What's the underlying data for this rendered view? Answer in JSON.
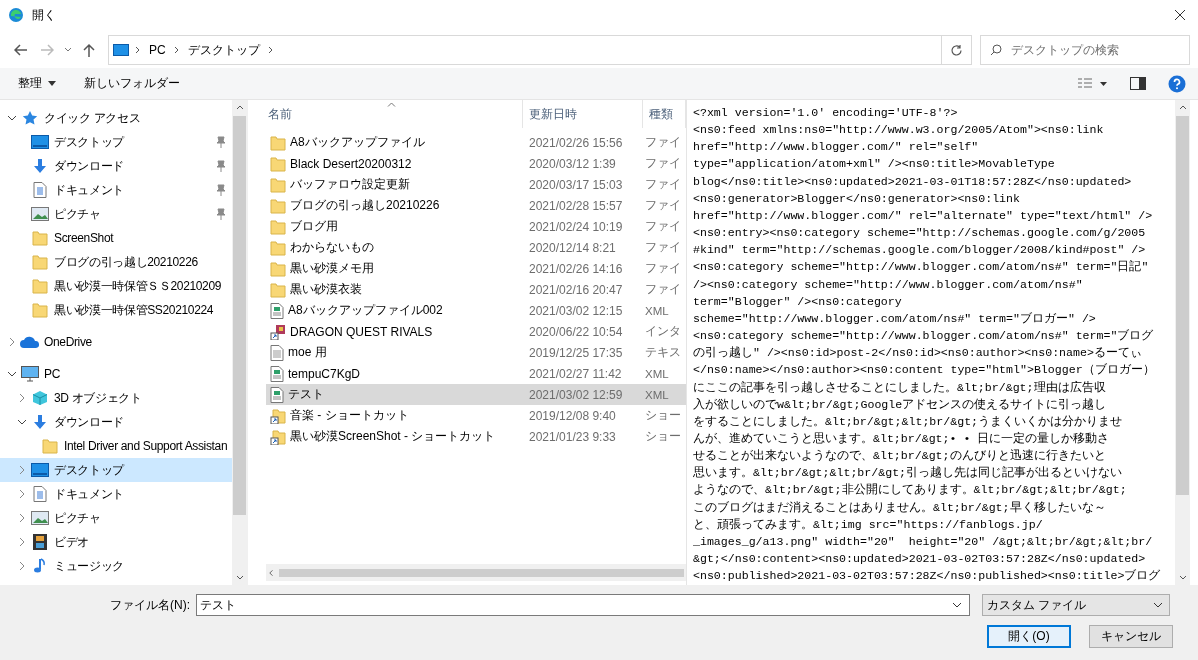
{
  "window": {
    "title": "開く"
  },
  "address": {
    "path": [
      "PC",
      "デスクトップ"
    ]
  },
  "search": {
    "placeholder": "デスクトップの検索"
  },
  "toolbar": {
    "organize": "整理",
    "new_folder": "新しいフォルダー"
  },
  "sidebar": {
    "items": [
      {
        "label": "クイック アクセス",
        "kind": "star",
        "expanded": true,
        "selected": false,
        "children": [
          {
            "label": "デスクトップ",
            "kind": "desktop",
            "pinned": true,
            "selected": false
          },
          {
            "label": "ダウンロード",
            "kind": "download",
            "pinned": true,
            "selected": false
          },
          {
            "label": "ドキュメント",
            "kind": "document",
            "pinned": true,
            "selected": false
          },
          {
            "label": "ピクチャ",
            "kind": "picture",
            "pinned": true,
            "selected": false
          },
          {
            "label": "ScreenShot",
            "kind": "folder",
            "pinned": false,
            "selected": false
          },
          {
            "label": "ブログの引っ越し20210226",
            "kind": "folder",
            "pinned": false,
            "selected": false
          },
          {
            "label": "黒い砂漠一時保管ＳＳ20210209",
            "kind": "folder",
            "pinned": false,
            "selected": false
          },
          {
            "label": "黒い砂漠一時保管SS20210224",
            "kind": "folder",
            "pinned": false,
            "selected": false
          }
        ]
      },
      {
        "label": "OneDrive",
        "kind": "cloud",
        "expanded": false,
        "selected": false
      },
      {
        "label": "PC",
        "kind": "pc",
        "expanded": true,
        "selected": false,
        "children": [
          {
            "label": "3D オブジェクト",
            "kind": "cube",
            "expanded": false,
            "selected": false
          },
          {
            "label": "ダウンロード",
            "kind": "download",
            "expanded": true,
            "selected": false,
            "children": [
              {
                "label": "Intel Driver and Support Assistan",
                "kind": "folder",
                "selected": false
              }
            ]
          },
          {
            "label": "デスクトップ",
            "kind": "desktop",
            "expanded": false,
            "selected": true
          },
          {
            "label": "ドキュメント",
            "kind": "document",
            "expanded": false,
            "selected": false
          },
          {
            "label": "ピクチャ",
            "kind": "picture",
            "expanded": false,
            "selected": false
          },
          {
            "label": "ビデオ",
            "kind": "video",
            "expanded": false,
            "selected": false
          },
          {
            "label": "ミュージック",
            "kind": "music",
            "expanded": false,
            "selected": false
          }
        ]
      }
    ]
  },
  "table": {
    "columns": [
      "名前",
      "更新日時",
      "種類"
    ],
    "rows": [
      {
        "name": "A8バックアップファイル",
        "date": "2021/02/26 15:56",
        "type": "ファイ",
        "kind": "folder",
        "selected": false
      },
      {
        "name": "Black Desert20200312",
        "date": "2020/03/12 1:39",
        "type": "ファイ",
        "kind": "folder",
        "selected": false
      },
      {
        "name": "バッファロウ設定更新",
        "date": "2020/03/17 15:03",
        "type": "ファイ",
        "kind": "folder",
        "selected": false
      },
      {
        "name": "ブログの引っ越し20210226",
        "date": "2021/02/28 15:57",
        "type": "ファイ",
        "kind": "folder",
        "selected": false
      },
      {
        "name": "ブログ用",
        "date": "2021/02/24 10:19",
        "type": "ファイ",
        "kind": "folder",
        "selected": false
      },
      {
        "name": "わからないもの",
        "date": "2020/12/14 8:21",
        "type": "ファイ",
        "kind": "folder",
        "selected": false
      },
      {
        "name": "黒い砂漠メモ用",
        "date": "2021/02/26 14:16",
        "type": "ファイ",
        "kind": "folder",
        "selected": false
      },
      {
        "name": "黒い砂漠衣装",
        "date": "2021/02/16 20:47",
        "type": "ファイ",
        "kind": "folder",
        "selected": false
      },
      {
        "name": "A8バックアップファイル002",
        "date": "2021/03/02 12:15",
        "type": "XML",
        "kind": "xml",
        "selected": false
      },
      {
        "name": "DRAGON QUEST RIVALS",
        "date": "2020/06/22 10:54",
        "type": "インタ",
        "kind": "app-shortcut",
        "selected": false
      },
      {
        "name": "moe 用",
        "date": "2019/12/25 17:35",
        "type": "テキス",
        "kind": "text",
        "selected": false
      },
      {
        "name": "tempuC7KgD",
        "date": "2021/02/27 11:42",
        "type": "XML",
        "kind": "xml",
        "selected": false
      },
      {
        "name": "テスト",
        "date": "2021/03/02 12:59",
        "type": "XML",
        "kind": "xml",
        "selected": true
      },
      {
        "name": "音楽 - ショートカット",
        "date": "2019/12/08 9:40",
        "type": "ショー",
        "kind": "folder-shortcut",
        "selected": false
      },
      {
        "name": "黒い砂漠ScreenShot - ショートカット",
        "date": "2021/01/23 9:33",
        "type": "ショー",
        "kind": "folder-shortcut",
        "selected": false
      }
    ]
  },
  "preview": {
    "lines": [
      "<?xml version='1.0' encoding='UTF-8'?>",
      "<ns0:feed xmlns:ns0=\"http://www.w3.org/2005/Atom\"><ns0:link",
      "href=\"http://www.blogger.com/\" rel=\"self\"",
      "type=\"application/atom+xml\" /><ns0:title>MovableType",
      "blog</ns0:title><ns0:updated>2021-03-01T18:57:28Z</ns0:updated>",
      "<ns0:generator>Blogger</ns0:generator><ns0:link",
      "href=\"http://www.blogger.com/\" rel=\"alternate\" type=\"text/html\" />",
      "<ns0:entry><ns0:category scheme=\"http://schemas.google.com/g/2005",
      "#kind\" term=\"http://schemas.google.com/blogger/2008/kind#post\" />",
      "<ns0:category scheme=\"http://www.blogger.com/atom/ns#\" term=\"日記\"",
      "/><ns0:category scheme=\"http://www.blogger.com/atom/ns#\"",
      "term=\"Blogger\" /><ns0:category",
      "scheme=\"http://www.blogger.com/atom/ns#\" term=\"ブロガー\" />",
      "<ns0:category scheme=\"http://www.blogger.com/atom/ns#\" term=\"ブログ",
      "の引っ越し\" /><ns0:id>post-2</ns0:id><ns0:author><ns0:name>るーてぃ",
      "</ns0:name></ns0:author><ns0:content type=\"html\">Blogger（ブロガー）",
      "にここの記事を引っ越しさせることにしました。&lt;br/&gt;理由は広告収",
      "入が欲しいのでw&lt;br/&gt;Googleアドセンスの使えるサイトに引っ越し",
      "をすることにしました。&lt;br/&gt;&lt;br/&gt;うまくいくかは分かりませ",
      "んが、進めていこうと思います。&lt;br/&gt;• • 日に一定の量しか移動さ",
      "せることが出来ないようなので、&lt;br/&gt;のんびりと迅速に行きたいと",
      "思います。&lt;br/&gt;&lt;br/&gt;引っ越し先は同じ記事が出るといけない",
      "ようなので、&lt;br/&gt;非公開にしてあります。&lt;br/&gt;&lt;br/&gt;",
      "このブログはまだ消えることはありません。&lt;br/&gt;早く移したいな～",
      "と、頑張ってみます。&lt;img src=\"https://fanblogs.jp/",
      "_images_g/a13.png\" width=\"20\"  height=\"20\" /&gt;&lt;br/&gt;&lt;br/",
      "&gt;</ns0:content><ns0:updated>2021-03-02T03:57:28Z</ns0:updated>",
      "<ns0:published>2021-03-02T03:57:28Z</ns0:published><ns0:title>ブログ"
    ]
  },
  "footer": {
    "filename_label": "ファイル名(N):",
    "filename": "テスト",
    "filter": "カスタム ファイル",
    "buttons": [
      {
        "label": "開く(O)",
        "default": true
      },
      {
        "label": "キャンセル",
        "default": false
      }
    ]
  }
}
